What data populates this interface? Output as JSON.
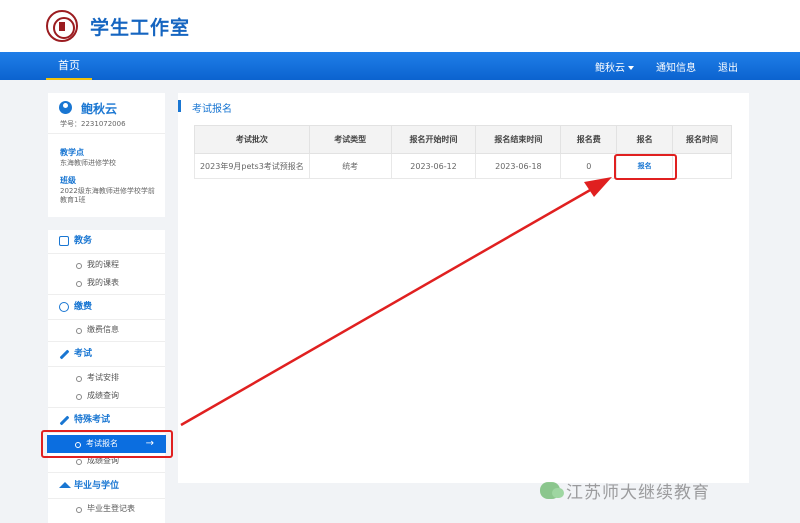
{
  "header": {
    "site_title": "学生工作室"
  },
  "nav": {
    "home": "首页",
    "user_menu": "鲍秋云",
    "notice": "通知信息",
    "logout": "退出"
  },
  "user": {
    "name": "鲍秋云",
    "student_id": "学号：2231072006",
    "site_label": "教学点",
    "site_value": "东海教师进修学校",
    "class_label": "班级",
    "class_value": "2022级东海教师进修学校学前教育1班"
  },
  "menu": {
    "academic": {
      "title": "教务",
      "items": [
        "我的课程",
        "我的课表"
      ]
    },
    "fees": {
      "title": "缴费",
      "items": [
        "缴费信息"
      ]
    },
    "exam": {
      "title": "考试",
      "items": [
        "考试安排",
        "成绩查询"
      ]
    },
    "special_exam": {
      "title": "特殊考试",
      "items": [
        "考试报名",
        "成绩查询"
      ],
      "active_arrow": "→"
    },
    "graduation": {
      "title": "毕业与学位",
      "items": [
        "毕业生登记表"
      ]
    }
  },
  "content": {
    "title": "考试报名",
    "columns": [
      "考试批次",
      "考试类型",
      "报名开始时间",
      "报名结束时间",
      "报名费",
      "报名",
      "报名时间"
    ],
    "rows": [
      {
        "batch": "2023年9月pets3考试预报名",
        "type": "统考",
        "start": "2023-06-12",
        "end": "2023-06-18",
        "fee": "0",
        "action": "报名",
        "time": ""
      }
    ]
  },
  "watermark": {
    "text": "江苏师大继续教育",
    "icon": "wechat-icon"
  },
  "colors": {
    "primary": "#1976d2",
    "nav": "#0b63cf",
    "highlight": "#e02020",
    "nav_active": "#f0c20c"
  }
}
